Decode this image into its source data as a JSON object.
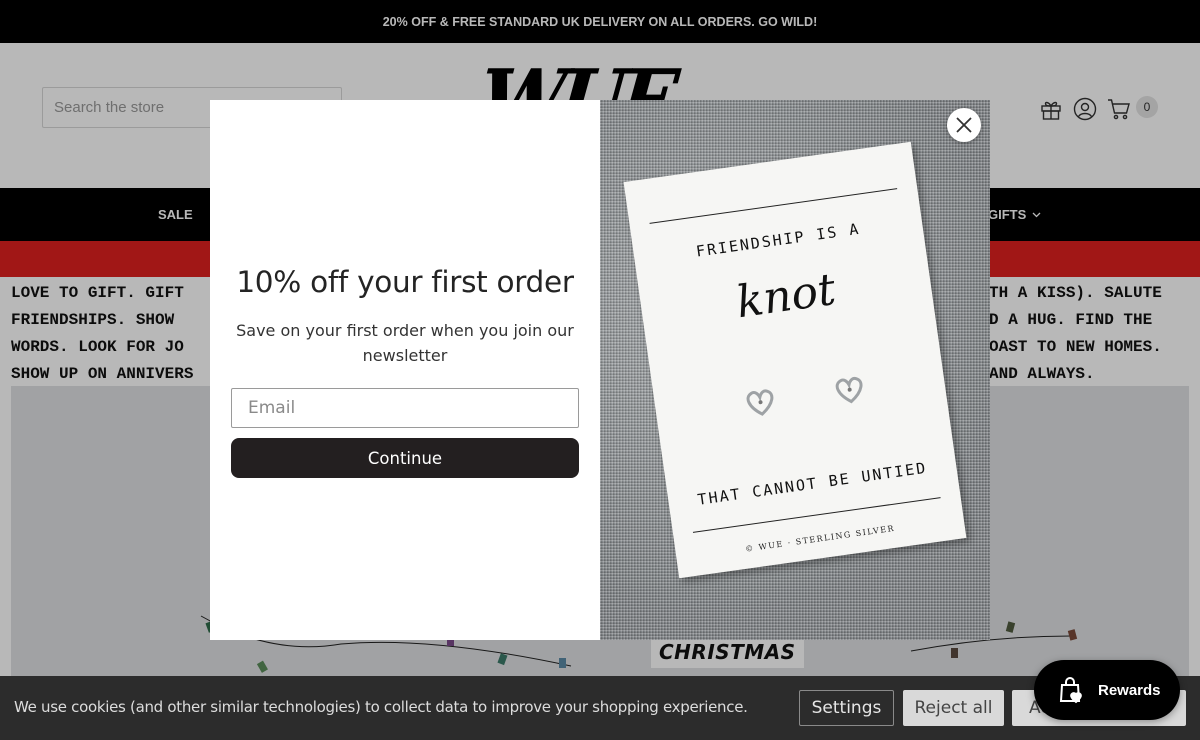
{
  "announcement": "20% OFF & FREE STANDARD UK DELIVERY ON ALL ORDERS. GO WILD!",
  "header": {
    "search_placeholder": "Search the store",
    "logo_text": "WUE",
    "cart_count": "0",
    "icons": [
      "gift-icon",
      "account-icon",
      "cart-icon"
    ]
  },
  "nav": {
    "sale_label": "SALE",
    "gifts_label": "GIFTS"
  },
  "intro": {
    "lines": [
      "LOVE TO GIFT. GIFT",
      "FRIENDSHIPS. SHOW",
      "WORDS. LOOK FOR JO",
      "SHOW UP ON ANNIVERS"
    ],
    "right_lines": [
      "TH A KISS). SALUTE",
      "D A HUG. FIND THE",
      "OAST TO NEW HOMES.",
      "AND ALWAYS."
    ]
  },
  "hero": {
    "tag": "CHRISTMAS"
  },
  "modal": {
    "title": "10% off your first order",
    "subtitle": "Save on your first order when you join our newsletter",
    "email_placeholder": "Email",
    "continue_label": "Continue",
    "card": {
      "line1": "FRIENDSHIP IS A",
      "script": "knot",
      "line2": "THAT CANNOT BE UNTIED",
      "brand": "© WUE · STERLING SILVER"
    }
  },
  "cookie": {
    "text": "We use cookies (and other similar technologies) to collect data to improve your shopping experience.",
    "settings_label": "Settings",
    "reject_label": "Reject all",
    "accept_label": "Accept all"
  },
  "rewards": {
    "label": "Rewards"
  },
  "colors": {
    "nav_bg": "#000000",
    "red_bar": "#e0201f",
    "button_dark": "#231f20",
    "cookie_bg": "#2c2c2c"
  }
}
